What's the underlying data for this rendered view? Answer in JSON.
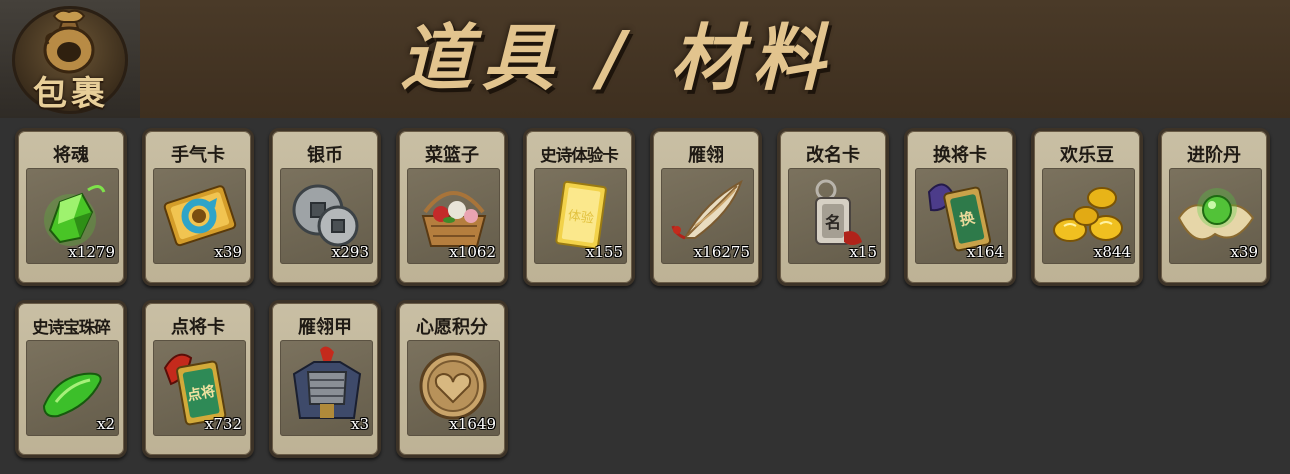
{
  "header": {
    "bag_label": "包裹",
    "title": "道具 / 材料"
  },
  "items": [
    {
      "name": "将魂",
      "qty": "x1279",
      "icon": "green-crystal-icon"
    },
    {
      "name": "手气卡",
      "qty": "x39",
      "icon": "luck-card-icon"
    },
    {
      "name": "银币",
      "qty": "x293",
      "icon": "silver-coins-icon"
    },
    {
      "name": "菜篮子",
      "qty": "x1062",
      "icon": "flower-basket-icon"
    },
    {
      "name": "史诗体验卡",
      "qty": "x155",
      "icon": "gold-card-icon"
    },
    {
      "name": "雁翎",
      "qty": "x16275",
      "icon": "feather-icon"
    },
    {
      "name": "改名卡",
      "qty": "x15",
      "icon": "rename-tag-icon"
    },
    {
      "name": "换将卡",
      "qty": "x164",
      "icon": "swap-general-card-icon"
    },
    {
      "name": "欢乐豆",
      "qty": "x844",
      "icon": "gold-beans-icon"
    },
    {
      "name": "进阶丹",
      "qty": "x39",
      "icon": "green-pill-icon"
    },
    {
      "name": "史诗宝珠碎",
      "qty": "x2",
      "icon": "green-shard-icon"
    },
    {
      "name": "点将卡",
      "qty": "x732",
      "icon": "select-general-card-icon"
    },
    {
      "name": "雁翎甲",
      "qty": "x3",
      "icon": "armor-icon"
    },
    {
      "name": "心愿积分",
      "qty": "x1649",
      "icon": "heart-coin-icon"
    }
  ]
}
